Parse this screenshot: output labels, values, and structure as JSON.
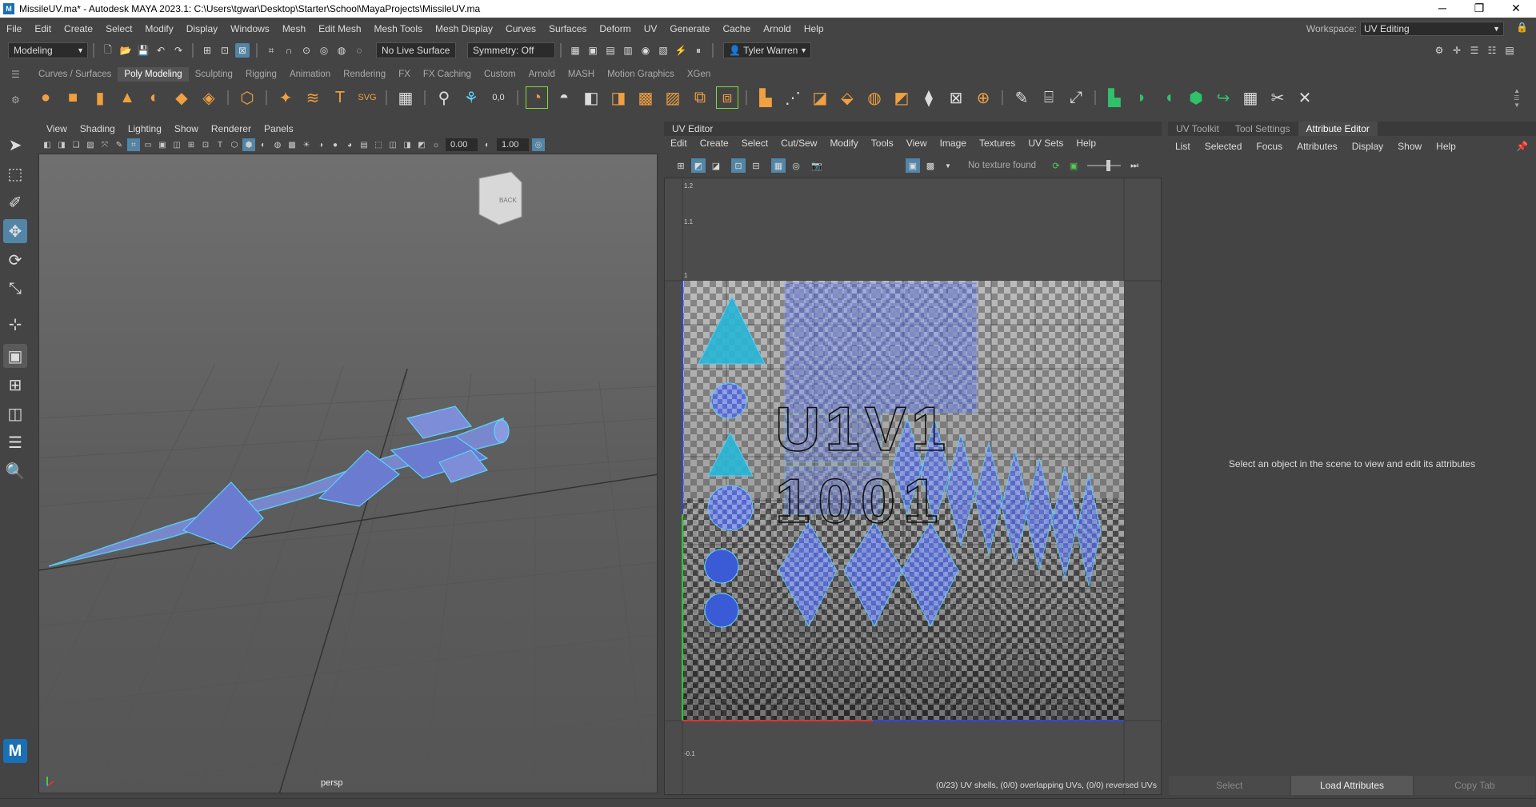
{
  "title": "MissileUV.ma* - Autodesk MAYA 2023.1: C:\\Users\\tgwar\\Desktop\\Starter\\School\\MayaProjects\\MissileUV.ma",
  "menus": [
    "File",
    "Edit",
    "Create",
    "Select",
    "Modify",
    "Display",
    "Windows",
    "Mesh",
    "Edit Mesh",
    "Mesh Tools",
    "Mesh Display",
    "Curves",
    "Surfaces",
    "Deform",
    "UV",
    "Generate",
    "Cache",
    "Arnold",
    "Help"
  ],
  "workspace": {
    "label": "Workspace:",
    "value": "UV Editing"
  },
  "status_line": {
    "menu_set": "Modeling",
    "live_surface": "No Live Surface",
    "symmetry": "Symmetry: Off",
    "user": "Tyler Warren"
  },
  "shelf_tabs": [
    "Curves / Surfaces",
    "Poly Modeling",
    "Sculpting",
    "Rigging",
    "Animation",
    "Rendering",
    "FX",
    "FX Caching",
    "Custom",
    "Arnold",
    "MASH",
    "Motion Graphics",
    "XGen"
  ],
  "shelf_active": "Poly Modeling",
  "viewport": {
    "menus": [
      "View",
      "Shading",
      "Lighting",
      "Show",
      "Renderer",
      "Panels"
    ],
    "field1": "0.00",
    "field2": "1.00",
    "camera": "persp",
    "viewcube_label": "BACK"
  },
  "uv_editor": {
    "title": "UV Editor",
    "menus": [
      "Edit",
      "Create",
      "Select",
      "Cut/Sew",
      "Modify",
      "Tools",
      "View",
      "Image",
      "Textures",
      "UV Sets",
      "Help"
    ],
    "texture": "No texture found",
    "tile_label_1": "U1V1",
    "tile_label_2": "1001",
    "axis_labels": [
      "1.2",
      "1.1",
      "1",
      "-0.1"
    ],
    "status": "(0/23) UV shells, (0/0) overlapping UVs, (0/0) reversed UVs"
  },
  "attribute_editor": {
    "tabs": [
      "UV Toolkit",
      "Tool Settings",
      "Attribute Editor"
    ],
    "active_tab": "Attribute Editor",
    "menus": [
      "List",
      "Selected",
      "Focus",
      "Attributes",
      "Display",
      "Show",
      "Help"
    ],
    "message": "Select an object in the scene to view and edit its attributes",
    "buttons": [
      "Select",
      "Load Attributes",
      "Copy Tab"
    ]
  },
  "colors": {
    "accent": "#5285a6",
    "uv_shell": "#3b5bd6",
    "mesh": "#5bd3ff"
  }
}
